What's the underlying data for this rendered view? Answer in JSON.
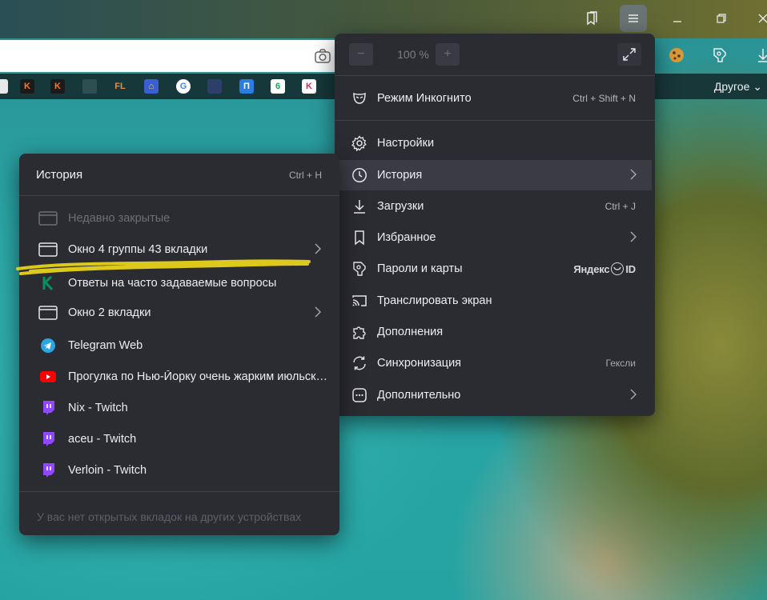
{
  "main_menu": {
    "zoom": {
      "minus": "−",
      "value": "100 %",
      "plus": "+"
    },
    "items": [
      {
        "label": "Режим Инкогнито",
        "shortcut": "Ctrl + Shift + N"
      },
      {
        "label": "Настройки"
      },
      {
        "label": "История"
      },
      {
        "label": "Загрузки",
        "shortcut": "Ctrl + J"
      },
      {
        "label": "Избранное"
      },
      {
        "label": "Пароли и карты",
        "badge_left": "Яндекс",
        "badge_right": "ID"
      },
      {
        "label": "Транслировать экран"
      },
      {
        "label": "Дополнения"
      },
      {
        "label": "Синхронизация",
        "hint": "Гексли"
      },
      {
        "label": "Дополнительно"
      }
    ]
  },
  "history_menu": {
    "title": "История",
    "shortcut": "Ctrl + H",
    "items": [
      {
        "label": "Недавно закрытые"
      },
      {
        "label": "Окно 4 группы 43 вкладки"
      },
      {
        "label": "Ответы на часто задаваемые вопросы"
      },
      {
        "label": "Окно 2 вкладки"
      },
      {
        "label": "Telegram Web"
      },
      {
        "label": "Прогулка по Нью-Йорку очень жарким июльским днём"
      },
      {
        "label": "Nix - Twitch"
      },
      {
        "label": "aceu - Twitch"
      },
      {
        "label": "Verloin - Twitch"
      }
    ],
    "footer": "У вас нет открытых вкладок на других устройствах"
  },
  "bookmarks": {
    "other_label": "Другое",
    "favicons": [
      "K",
      "K",
      "FL",
      "G",
      "П",
      "K"
    ]
  },
  "colors": {
    "panel_bg": "#2b2b32",
    "highlight": "#3b3b44",
    "telegram": "#2aa5e0",
    "youtube": "#ff0000",
    "twitch": "#9146ff",
    "kinopoisk_green": "#0b8f5e"
  }
}
